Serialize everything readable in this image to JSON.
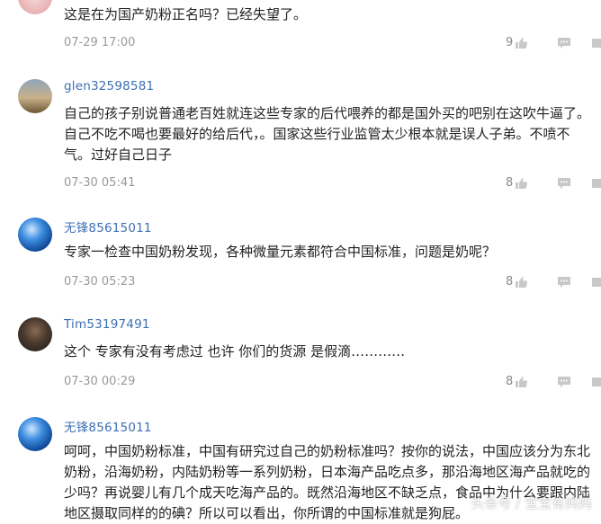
{
  "comments": [
    {
      "user": "",
      "text": "这是在为国产奶粉正名吗？已经失望了。",
      "time": "07-29 17:00",
      "likes": "9"
    },
    {
      "user": "glen32598581",
      "text": "自己的孩子别说普通老百姓就连这些专家的后代喂养的都是国外买的吧别在这吹牛逼了。自己不吃不喝也要最好的给后代，。国家这些行业监管太少根本就是误人子弟。不喷不气。过好自己日子",
      "time": "07-30 05:41",
      "likes": "8"
    },
    {
      "user": "无锋85615011",
      "text": "专家一检查中国奶粉发现，各种微量元素都符合中国标准，问题是奶呢？",
      "time": "07-30 05:23",
      "likes": "8"
    },
    {
      "user": "Tim53197491",
      "text": "这个 专家有没有考虑过 也许 你们的货源 是假滴…………",
      "time": "07-30 00:29",
      "likes": "8"
    },
    {
      "user": "无锋85615011",
      "text": "呵呵，中国奶粉标准，中国有研究过自己的奶粉标准吗？按你的说法，中国应该分为东北奶粉，沿海奶粉，内陆奶粉等一系列奶粉，日本海产品吃点多，那沿海地区海产品就吃的少吗？再说婴儿有几个成天吃海产品的。既然沿海地区不缺乏点，食品中为什么要跟内陆地区摄取同样的的碘？所以可以看出，你所谓的中国标准就是狗屁。"
    }
  ],
  "watermark": "头条号 / 宝宝有妈妈",
  "icons": {
    "like": "thumbs-up-icon",
    "reply": "comment-icon",
    "more": "more-icon"
  }
}
